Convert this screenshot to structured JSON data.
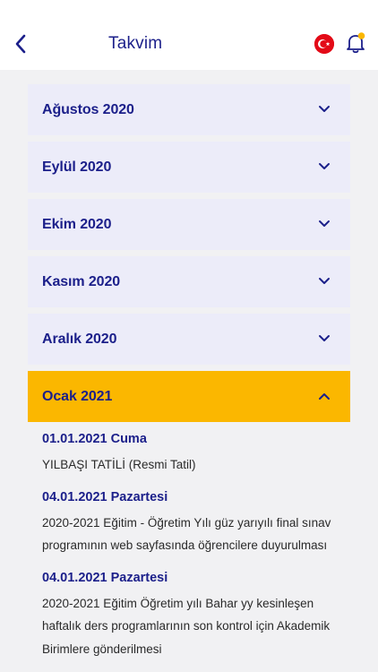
{
  "header": {
    "title": "Takvim",
    "icons": {
      "back": "chevron-left-icon",
      "flag": "turkish-flag-icon",
      "bell": "bell-icon"
    },
    "colors": {
      "title": "#1b1f8a",
      "flag": "#e30a17",
      "badge": "#fbb700"
    }
  },
  "months": [
    {
      "label": "Ağustos 2020",
      "expanded": false
    },
    {
      "label": "Eylül 2020",
      "expanded": false
    },
    {
      "label": "Ekim 2020",
      "expanded": false
    },
    {
      "label": "Kasım 2020",
      "expanded": false
    },
    {
      "label": "Aralık 2020",
      "expanded": false
    },
    {
      "label": "Ocak 2021",
      "expanded": true
    }
  ],
  "events": [
    {
      "date": "01.01.2021 Cuma",
      "description": "YILBAŞI TATİLİ (Resmi Tatil)"
    },
    {
      "date": "04.01.2021 Pazartesi",
      "description": "2020-2021 Eğitim - Öğretim Yılı güz yarıyılı final sınav programının web sayfasında öğrencilere duyurulması"
    },
    {
      "date": "04.01.2021 Pazartesi",
      "description": "2020-2021 Eğitim Öğretim yılı Bahar yy kesinleşen haftalık ders programlarının son kontrol için Akademik Birimlere gönderilmesi"
    }
  ],
  "colors": {
    "accent": "#1b1f8a",
    "collapsed_row": "#ececf9",
    "expanded_row": "#fbb700",
    "background": "#f1f1f3"
  }
}
